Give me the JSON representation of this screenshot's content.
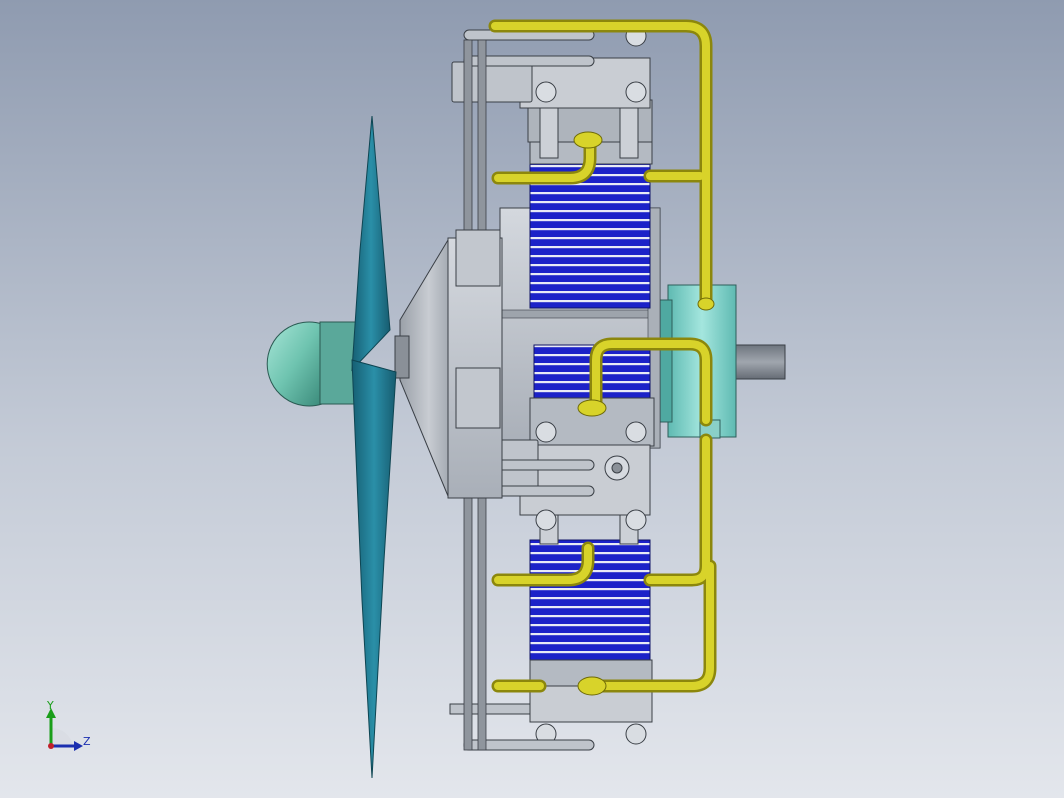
{
  "viewport": {
    "model": "radial-engine-assembly"
  },
  "triad": {
    "y_label": "Y",
    "z_label": "Z",
    "colors": {
      "y": "#1a9e1a",
      "z": "#1b2fb0",
      "x": "#c0202a"
    }
  },
  "colors": {
    "background_top": "#8f9bb0",
    "background_bottom": "#e3e6ec",
    "propeller": "#1f7e96",
    "spinner": "#6fc4b0",
    "cylinder_fins": "#1c22c8",
    "fuel_lines": "#c9c414",
    "engine_body": "#b8bec6",
    "hub": "#7fd6cf"
  }
}
